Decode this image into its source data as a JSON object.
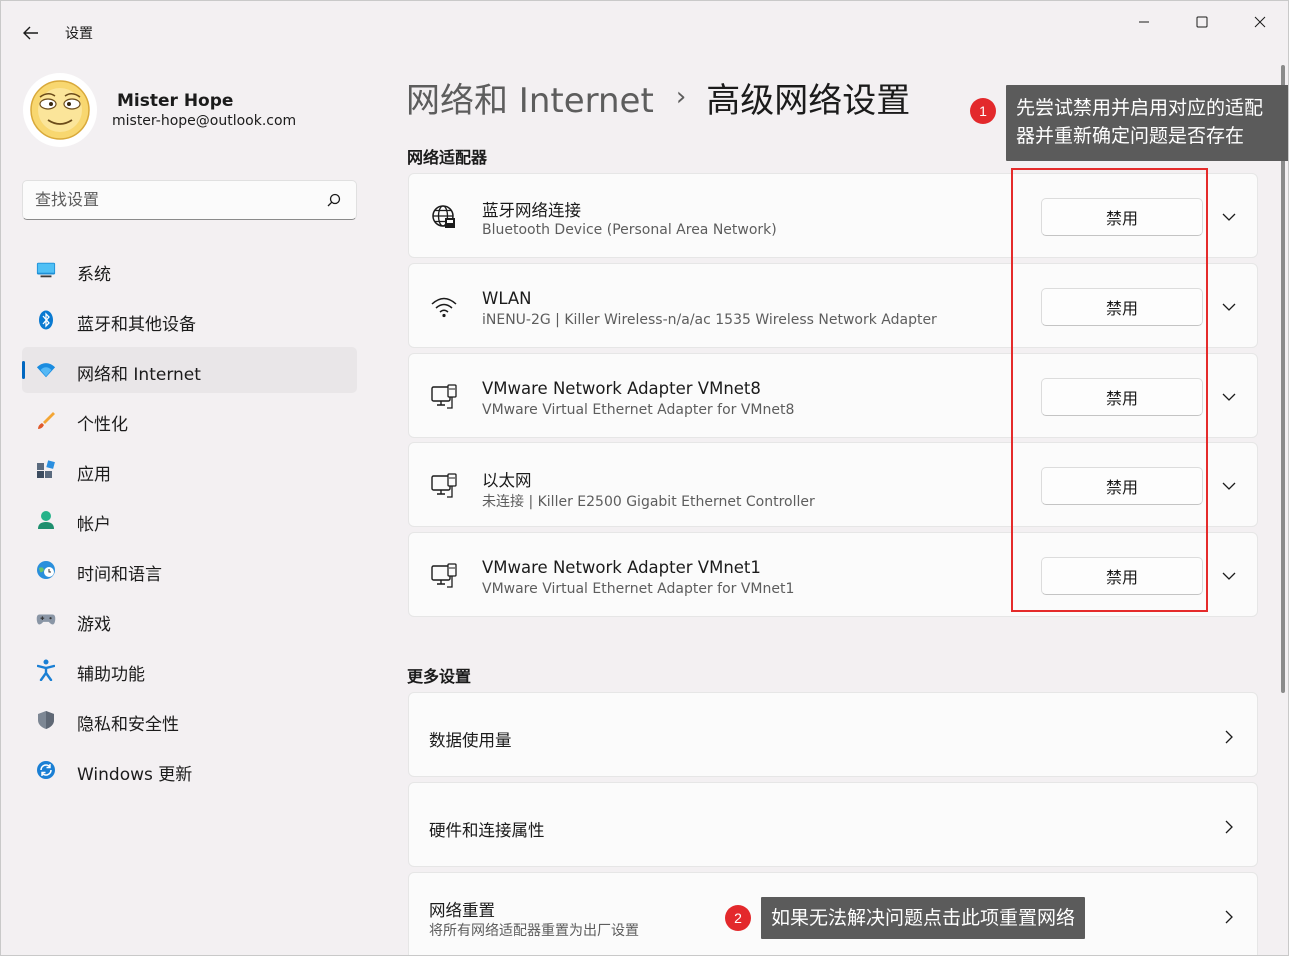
{
  "window": {
    "app_title": "设置",
    "controls": {
      "minimize": "minimize-icon",
      "maximize": "maximize-icon",
      "close": "close-icon"
    }
  },
  "profile": {
    "name": "Mister Hope",
    "email": "mister-hope@outlook.com"
  },
  "search": {
    "placeholder": "查找设置",
    "value": ""
  },
  "sidebar": {
    "items": [
      {
        "label": "系统",
        "icon": "system-icon"
      },
      {
        "label": "蓝牙和其他设备",
        "icon": "bluetooth-icon"
      },
      {
        "label": "网络和 Internet",
        "icon": "wifi-icon",
        "active": true
      },
      {
        "label": "个性化",
        "icon": "brush-icon"
      },
      {
        "label": "应用",
        "icon": "apps-icon"
      },
      {
        "label": "帐户",
        "icon": "account-icon"
      },
      {
        "label": "时间和语言",
        "icon": "globe-clock-icon"
      },
      {
        "label": "游戏",
        "icon": "gamepad-icon"
      },
      {
        "label": "辅助功能",
        "icon": "accessibility-icon"
      },
      {
        "label": "隐私和安全性",
        "icon": "shield-icon"
      },
      {
        "label": "Windows 更新",
        "icon": "update-icon"
      }
    ]
  },
  "header": {
    "breadcrumb_parent": "网络和 Internet",
    "breadcrumb_sep": "›",
    "breadcrumb_current": "高级网络设置"
  },
  "adapters": {
    "section_label": "网络适配器",
    "button_label": "禁用",
    "items": [
      {
        "title": "蓝牙网络连接",
        "subtitle": "Bluetooth Device (Personal Area Network)",
        "icon": "globe-network-icon"
      },
      {
        "title": "WLAN",
        "subtitle": "iNENU-2G | Killer Wireless-n/a/ac 1535 Wireless Network Adapter",
        "icon": "wifi-icon"
      },
      {
        "title": "VMware Network Adapter VMnet8",
        "subtitle": "VMware Virtual Ethernet Adapter for VMnet8",
        "icon": "ethernet-icon"
      },
      {
        "title": "以太网",
        "subtitle": "未连接 | Killer E2500 Gigabit Ethernet Controller",
        "icon": "ethernet-icon"
      },
      {
        "title": "VMware Network Adapter VMnet1",
        "subtitle": "VMware Virtual Ethernet Adapter for VMnet1",
        "icon": "ethernet-icon"
      }
    ]
  },
  "more_settings": {
    "section_label": "更多设置",
    "items": [
      {
        "title": "数据使用量",
        "subtitle": ""
      },
      {
        "title": "硬件和连接属性",
        "subtitle": ""
      },
      {
        "title": "网络重置",
        "subtitle": "将所有网络适配器重置为出厂设置"
      }
    ]
  },
  "annotations": {
    "note1": {
      "number": "1",
      "line1": "先尝试禁用并启用对应的适配",
      "line2": "器并重新确定问题是否存在"
    },
    "note2": {
      "number": "2",
      "text": "如果无法解决问题点击此项重置网络"
    }
  },
  "colors": {
    "accent": "#0067c0",
    "annotation_red": "#e3292c",
    "tooltip_bg": "#5b5b5b"
  }
}
